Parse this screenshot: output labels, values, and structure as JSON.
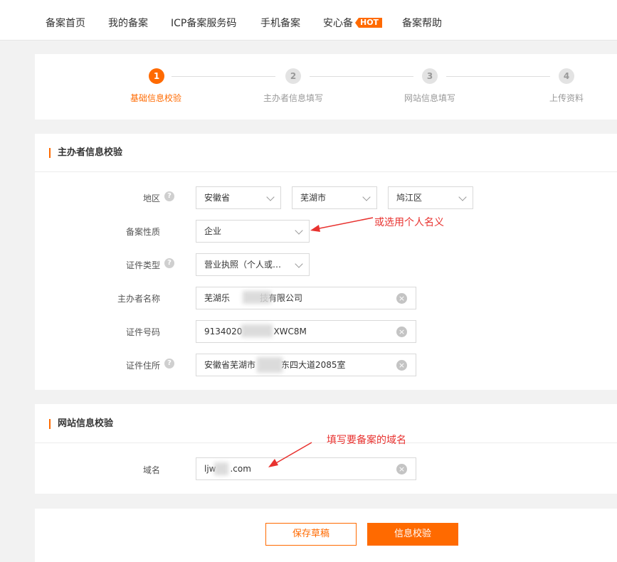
{
  "nav": {
    "items": [
      {
        "label": "备案首页"
      },
      {
        "label": "我的备案"
      },
      {
        "label": "ICP备案服务码"
      },
      {
        "label": "手机备案"
      },
      {
        "label": "安心备",
        "badge": "HOT"
      },
      {
        "label": "备案帮助"
      }
    ]
  },
  "steps": [
    {
      "num": "1",
      "label": "基础信息校验",
      "active": true
    },
    {
      "num": "2",
      "label": "主办者信息填写",
      "active": false
    },
    {
      "num": "3",
      "label": "网站信息填写",
      "active": false
    },
    {
      "num": "4",
      "label": "上传资料",
      "active": false
    }
  ],
  "sponsor_section": {
    "title": "主办者信息校验",
    "region_label": "地区",
    "region_province": "安徽省",
    "region_city": "芜湖市",
    "region_district": "鸠江区",
    "type_label": "备案性质",
    "type_value": "企业",
    "cert_type_label": "证件类型",
    "cert_type_value": "营业执照（个人或企...",
    "name_label": "主办者名称",
    "name_value_a": "芜湖乐",
    "name_value_b": "技有限公司",
    "cert_no_label": "证件号码",
    "cert_no_a": "9134020",
    "cert_no_b": "XWC8M",
    "address_label": "证件住所",
    "address_a": "安徽省芜湖市",
    "address_b": "东四大道2085室"
  },
  "site_section": {
    "title": "网站信息校验",
    "domain_label": "域名",
    "domain_a": "ljw",
    "domain_b": ".com"
  },
  "annotations": {
    "type_note": "或选用个人名义",
    "domain_note": "填写要备案的域名"
  },
  "actions": {
    "save_draft": "保存草稿",
    "verify": "信息校验"
  },
  "colors": {
    "accent": "#ff6a00",
    "annotation": "#e8322f"
  },
  "icons": {
    "help": "?",
    "clear": "×"
  }
}
